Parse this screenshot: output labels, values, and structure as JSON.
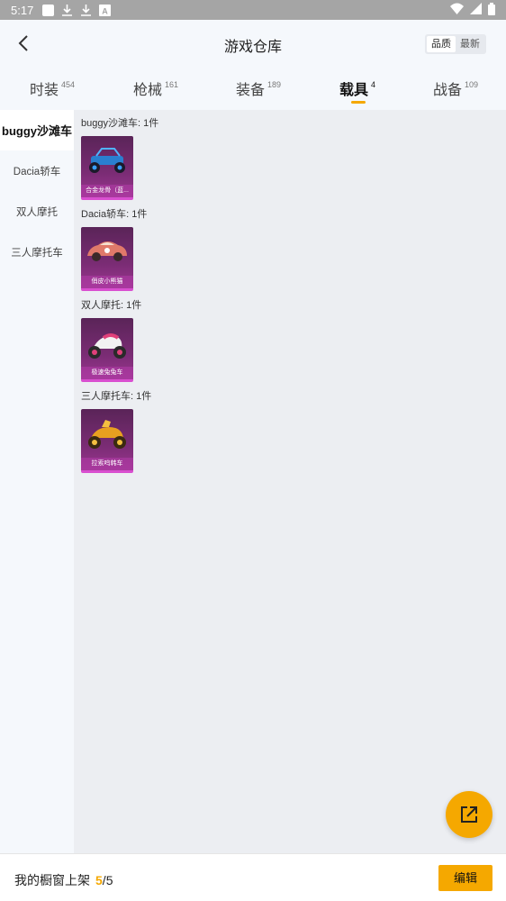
{
  "status_bar": {
    "time": "5:17"
  },
  "header": {
    "title": "游戏仓库",
    "sort_options": [
      "品质",
      "最新"
    ],
    "active_sort": 0
  },
  "tabs": [
    {
      "label": "时装",
      "count": "454"
    },
    {
      "label": "枪械",
      "count": "161"
    },
    {
      "label": "装备",
      "count": "189"
    },
    {
      "label": "载具",
      "count": "4"
    },
    {
      "label": "战备",
      "count": "109"
    }
  ],
  "active_tab": 3,
  "sidebar": {
    "items": [
      {
        "label": "buggy沙滩车"
      },
      {
        "label": "Dacia轿车"
      },
      {
        "label": "双人摩托"
      },
      {
        "label": "三人摩托车"
      }
    ],
    "active_index": 0
  },
  "groups": [
    {
      "title": "buggy沙滩车: 1件",
      "item": {
        "name": "合金龙骨（蓝...",
        "icon": "buggy-vehicle-icon"
      }
    },
    {
      "title": "Dacia轿车: 1件",
      "item": {
        "name": "俏皮小熊猫",
        "icon": "sedan-car-icon"
      }
    },
    {
      "title": "双人摩托: 1件",
      "item": {
        "name": "极速兔兔车",
        "icon": "motorcycle-icon"
      }
    },
    {
      "title": "三人摩托车: 1件",
      "item": {
        "name": "拉索呜韩车",
        "icon": "trike-icon"
      }
    }
  ],
  "bottom_bar": {
    "label": "我的橱窗上架",
    "count": "5",
    "separator": "/",
    "total": "5",
    "edit_label": "编辑"
  },
  "colors": {
    "accent": "#f5a800",
    "card_bg": "#7a2c74",
    "card_border": "#d94fd0"
  }
}
